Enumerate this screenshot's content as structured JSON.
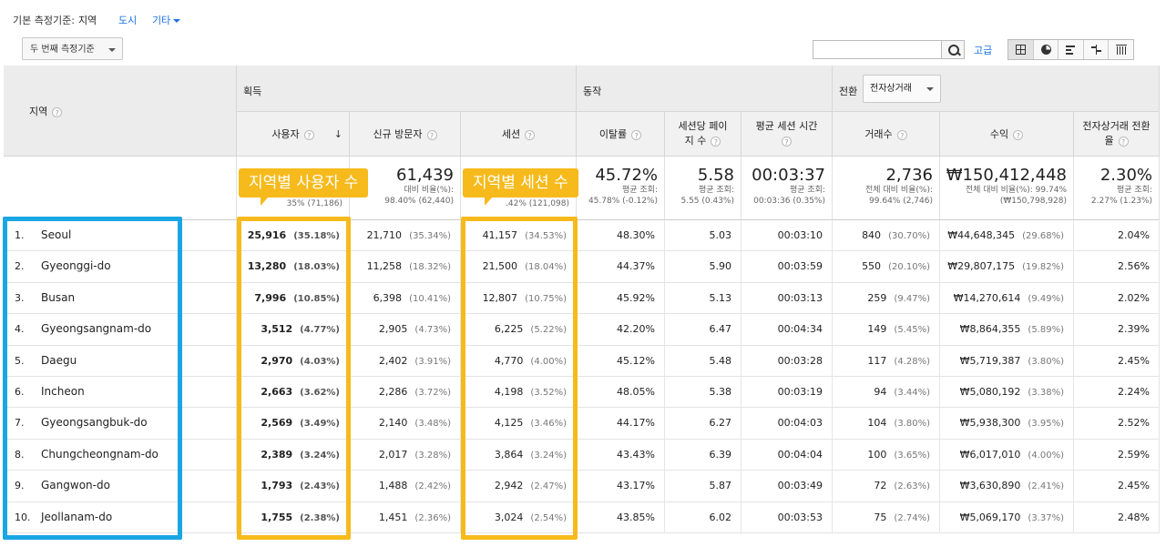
{
  "top": {
    "primary_label": "기본 측정기준:",
    "primary_value": "지역",
    "city_link": "도시",
    "other_link": "기타"
  },
  "controls": {
    "secondary_dim": "두 번째 측정기준",
    "search_placeholder": "",
    "advanced": "고급"
  },
  "headers": {
    "region": "지역",
    "acq": "획득",
    "behavior": "동작",
    "conv": "전환",
    "conv_select": "전자상거래",
    "users": "사용자",
    "new_users": "신규 방문자",
    "sessions": "세션",
    "bounce": "이탈률",
    "pages": "세션당 페이지 수",
    "avg_dur": "평균 세션 시간",
    "txn": "거래수",
    "revenue": "수익",
    "ecom_rate": "전자상거래 전환율"
  },
  "totals": {
    "users_sub": "35% (71,186)",
    "new_users": "61,439",
    "new_users_sub1": "대비 비율(%):",
    "new_users_sub2": "98.40% (62,440)",
    "sessions_sub": ".42% (121,098)",
    "bounce": "45.72%",
    "bounce_sub1": "평균 조회:",
    "bounce_sub2": "45.78% (-0.12%)",
    "pages": "5.58",
    "pages_sub1": "평균 조회:",
    "pages_sub2": "5.55 (0.43%)",
    "dur": "00:03:37",
    "dur_sub1": "평균 조회:",
    "dur_sub2": "00:03:36 (0.35%)",
    "txn": "2,736",
    "txn_sub1": "전체 대비 비율(%):",
    "txn_sub2": "99.64% (2,746)",
    "revenue": "₩150,412,448",
    "revenue_sub1": "전체 대비 비율(%): 99.74%",
    "revenue_sub2": "(₩150,798,928)",
    "rate": "2.30%",
    "rate_sub1": "평균 조회:",
    "rate_sub2": "2.27% (1.23%)"
  },
  "rows": [
    {
      "idx": "1.",
      "region": "Seoul",
      "users": "25,916",
      "users_pct": "(35.18%)",
      "new": "21,710",
      "new_pct": "(35.34%)",
      "sessions": "41,157",
      "sessions_pct": "(34.53%)",
      "bounce": "48.30%",
      "pages": "5.03",
      "dur": "00:03:10",
      "txn": "840",
      "txn_pct": "(30.70%)",
      "rev": "₩44,648,345",
      "rev_pct": "(29.68%)",
      "rate": "2.04%"
    },
    {
      "idx": "2.",
      "region": "Gyeonggi-do",
      "users": "13,280",
      "users_pct": "(18.03%)",
      "new": "11,258",
      "new_pct": "(18.32%)",
      "sessions": "21,500",
      "sessions_pct": "(18.04%)",
      "bounce": "44.37%",
      "pages": "5.90",
      "dur": "00:03:59",
      "txn": "550",
      "txn_pct": "(20.10%)",
      "rev": "₩29,807,175",
      "rev_pct": "(19.82%)",
      "rate": "2.56%"
    },
    {
      "idx": "3.",
      "region": "Busan",
      "users": "7,996",
      "users_pct": "(10.85%)",
      "new": "6,398",
      "new_pct": "(10.41%)",
      "sessions": "12,807",
      "sessions_pct": "(10.75%)",
      "bounce": "45.92%",
      "pages": "5.13",
      "dur": "00:03:13",
      "txn": "259",
      "txn_pct": "(9.47%)",
      "rev": "₩14,270,614",
      "rev_pct": "(9.49%)",
      "rate": "2.02%"
    },
    {
      "idx": "4.",
      "region": "Gyeongsangnam-do",
      "users": "3,512",
      "users_pct": "(4.77%)",
      "new": "2,905",
      "new_pct": "(4.73%)",
      "sessions": "6,225",
      "sessions_pct": "(5.22%)",
      "bounce": "42.20%",
      "pages": "6.47",
      "dur": "00:04:34",
      "txn": "149",
      "txn_pct": "(5.45%)",
      "rev": "₩8,864,355",
      "rev_pct": "(5.89%)",
      "rate": "2.39%"
    },
    {
      "idx": "5.",
      "region": "Daegu",
      "users": "2,970",
      "users_pct": "(4.03%)",
      "new": "2,402",
      "new_pct": "(3.91%)",
      "sessions": "4,770",
      "sessions_pct": "(4.00%)",
      "bounce": "45.12%",
      "pages": "5.48",
      "dur": "00:03:28",
      "txn": "117",
      "txn_pct": "(4.28%)",
      "rev": "₩5,719,387",
      "rev_pct": "(3.80%)",
      "rate": "2.45%"
    },
    {
      "idx": "6.",
      "region": "Incheon",
      "users": "2,663",
      "users_pct": "(3.62%)",
      "new": "2,286",
      "new_pct": "(3.72%)",
      "sessions": "4,198",
      "sessions_pct": "(3.52%)",
      "bounce": "48.05%",
      "pages": "5.38",
      "dur": "00:03:19",
      "txn": "94",
      "txn_pct": "(3.44%)",
      "rev": "₩5,080,192",
      "rev_pct": "(3.38%)",
      "rate": "2.24%"
    },
    {
      "idx": "7.",
      "region": "Gyeongsangbuk-do",
      "users": "2,569",
      "users_pct": "(3.49%)",
      "new": "2,140",
      "new_pct": "(3.48%)",
      "sessions": "4,125",
      "sessions_pct": "(3.46%)",
      "bounce": "44.17%",
      "pages": "6.27",
      "dur": "00:04:03",
      "txn": "104",
      "txn_pct": "(3.80%)",
      "rev": "₩5,938,300",
      "rev_pct": "(3.95%)",
      "rate": "2.52%"
    },
    {
      "idx": "8.",
      "region": "Chungcheongnam-do",
      "users": "2,389",
      "users_pct": "(3.24%)",
      "new": "2,017",
      "new_pct": "(3.28%)",
      "sessions": "3,864",
      "sessions_pct": "(3.24%)",
      "bounce": "43.43%",
      "pages": "6.39",
      "dur": "00:04:04",
      "txn": "100",
      "txn_pct": "(3.65%)",
      "rev": "₩6,017,010",
      "rev_pct": "(4.00%)",
      "rate": "2.59%"
    },
    {
      "idx": "9.",
      "region": "Gangwon-do",
      "users": "1,793",
      "users_pct": "(2.43%)",
      "new": "1,488",
      "new_pct": "(2.42%)",
      "sessions": "2,942",
      "sessions_pct": "(2.47%)",
      "bounce": "43.17%",
      "pages": "5.87",
      "dur": "00:03:49",
      "txn": "72",
      "txn_pct": "(2.63%)",
      "rev": "₩3,630,890",
      "rev_pct": "(2.41%)",
      "rate": "2.45%"
    },
    {
      "idx": "10.",
      "region": "Jeollanam-do",
      "users": "1,755",
      "users_pct": "(2.38%)",
      "new": "1,451",
      "new_pct": "(2.36%)",
      "sessions": "3,024",
      "sessions_pct": "(2.54%)",
      "bounce": "43.85%",
      "pages": "6.02",
      "dur": "00:03:53",
      "txn": "75",
      "txn_pct": "(2.74%)",
      "rev": "₩5,069,170",
      "rev_pct": "(3.37%)",
      "rate": "2.48%"
    }
  ],
  "callouts": {
    "users": "지역별 사용자 수",
    "sessions": "지역별 세션 수"
  },
  "colors": {
    "highlight_blue": "#1aa6e4",
    "highlight_yellow": "#f6ba1c",
    "link": "#1a73e8"
  }
}
